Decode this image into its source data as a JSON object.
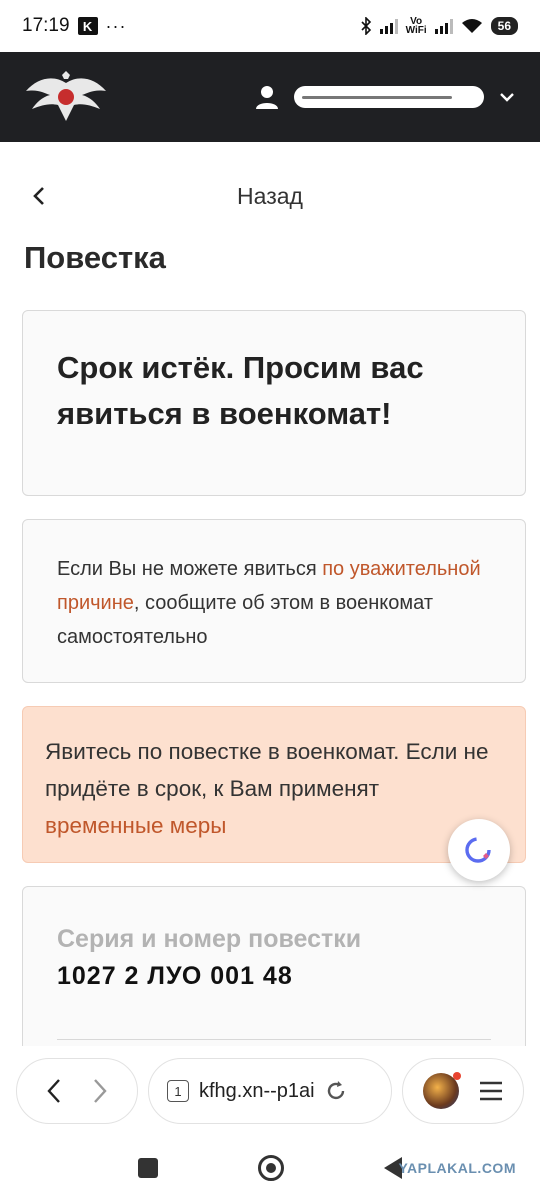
{
  "status_bar": {
    "time": "17:19",
    "k_badge": "K",
    "more": "···",
    "vowifi_top": "Vo",
    "vowifi_bottom": "WiFi",
    "battery": "56"
  },
  "header": {
    "emblem_icon": "eagle-emblem-icon",
    "user_icon": "person-icon"
  },
  "nav": {
    "back_label": "Назад"
  },
  "page": {
    "title": "Повестка"
  },
  "cards": {
    "expired": "Срок истёк. Просим вас явиться в военкомат!",
    "info_before": "Если Вы не можете явиться ",
    "info_link": "по уважительной причине",
    "info_after": ", сообщите об этом в военкомат самостоятельно",
    "warning_before": "Явитесь по повестке в военкомат. Если не придёте в срок, к Вам применят ",
    "warning_link": "временные меры",
    "summons_label": "Серия и номер повестки",
    "summons_value": "1027 2 ЛУО 001 48"
  },
  "browser": {
    "tab_count": "1",
    "url": "kfhg.xn--p1ai"
  },
  "watermark": "YAPLAKAL.COM",
  "colors": {
    "header_bg": "#1f2023",
    "link": "#c0572b",
    "warning_bg": "#fde0cf"
  }
}
